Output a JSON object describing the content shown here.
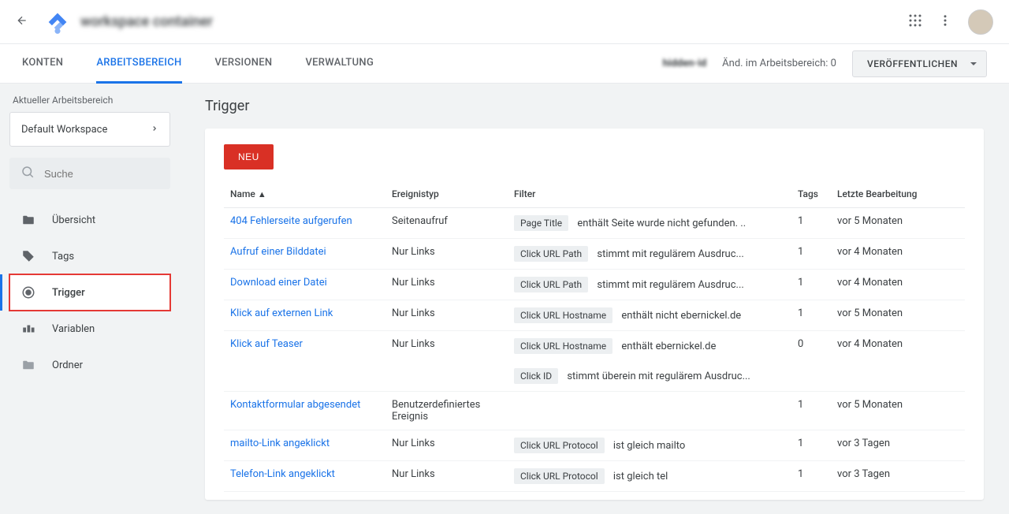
{
  "header": {
    "project_title": "workspace container",
    "apps_icon": "apps-icon",
    "more_icon": "more-icon"
  },
  "subnav": {
    "tabs": [
      "KONTEN",
      "ARBEITSBEREICH",
      "VERSIONEN",
      "VERWALTUNG"
    ],
    "active": 1,
    "obscured": "hidden-id",
    "changes": "Änd. im Arbeitsbereich: 0",
    "publish": "VERÖFFENTLICHEN"
  },
  "sidebar": {
    "ws_label": "Aktueller Arbeitsbereich",
    "ws_value": "Default Workspace",
    "search_placeholder": "Suche",
    "items": [
      {
        "label": "Übersicht",
        "icon": "folder-icon"
      },
      {
        "label": "Tags",
        "icon": "tag-icon"
      },
      {
        "label": "Trigger",
        "icon": "target-icon"
      },
      {
        "label": "Variablen",
        "icon": "blocks-icon"
      },
      {
        "label": "Ordner",
        "icon": "folder-gray-icon"
      }
    ],
    "active": 2
  },
  "page": {
    "heading": "Trigger",
    "new_btn": "NEU",
    "columns": {
      "name": "Name",
      "event": "Ereignistyp",
      "filter": "Filter",
      "tags": "Tags",
      "edited": "Letzte Bearbeitung"
    },
    "rows": [
      {
        "name": "404 Fehlerseite aufgerufen",
        "event": "Seitenaufruf",
        "filters": [
          {
            "chip": "Page Title",
            "text": "enthält Seite wurde nicht gefunden. .."
          }
        ],
        "tags": "1",
        "edited": "vor 5 Monaten"
      },
      {
        "name": "Aufruf einer Bilddatei",
        "event": "Nur Links",
        "filters": [
          {
            "chip": "Click URL Path",
            "text": "stimmt mit regulärem Ausdruc..."
          }
        ],
        "tags": "1",
        "edited": "vor 4 Monaten"
      },
      {
        "name": "Download einer Datei",
        "event": "Nur Links",
        "filters": [
          {
            "chip": "Click URL Path",
            "text": "stimmt mit regulärem Ausdruc..."
          }
        ],
        "tags": "1",
        "edited": "vor 4 Monaten"
      },
      {
        "name": "Klick auf externen Link",
        "event": "Nur Links",
        "filters": [
          {
            "chip": "Click URL Hostname",
            "text": "enthält nicht ebernickel.de"
          }
        ],
        "tags": "1",
        "edited": "vor 5 Monaten"
      },
      {
        "name": "Klick auf Teaser",
        "event": "Nur Links",
        "filters": [
          {
            "chip": "Click URL Hostname",
            "text": "enthält ebernickel.de"
          },
          {
            "chip": "Click ID",
            "text": "stimmt überein mit regulärem Ausdruc..."
          }
        ],
        "tags": "0",
        "edited": "vor 4 Monaten"
      },
      {
        "name": "Kontaktformular abgesendet",
        "event": "Benutzerdefiniertes Ereignis",
        "filters": [],
        "tags": "1",
        "edited": "vor 5 Monaten"
      },
      {
        "name": "mailto-Link angeklickt",
        "event": "Nur Links",
        "filters": [
          {
            "chip": "Click URL Protocol",
            "text": "ist gleich mailto"
          }
        ],
        "tags": "1",
        "edited": "vor 3 Tagen"
      },
      {
        "name": "Telefon-Link angeklickt",
        "event": "Nur Links",
        "filters": [
          {
            "chip": "Click URL Protocol",
            "text": "ist gleich tel"
          }
        ],
        "tags": "1",
        "edited": "vor 3 Tagen"
      }
    ]
  }
}
